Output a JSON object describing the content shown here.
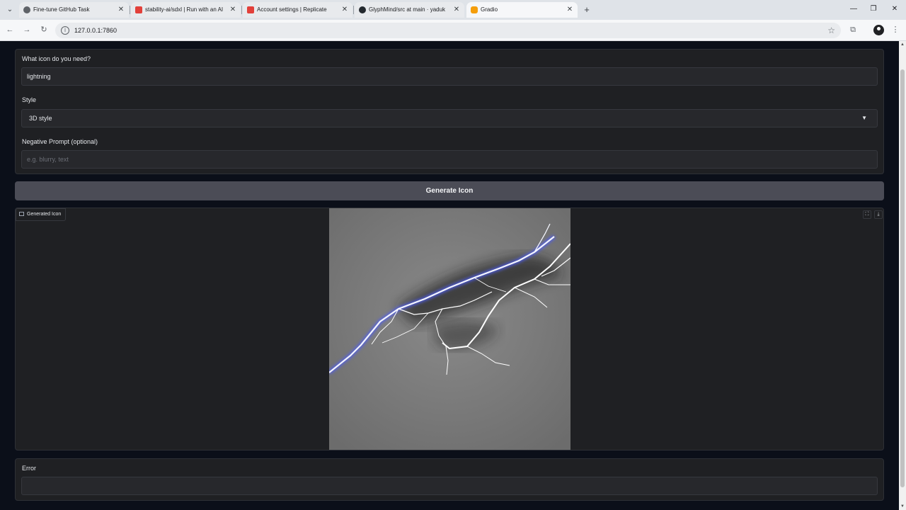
{
  "browser": {
    "tabs": [
      {
        "title": "Fine-tune GitHub Task",
        "active": false
      },
      {
        "title": "stability-ai/sdxl | Run with an AI",
        "active": false
      },
      {
        "title": "Account settings | Replicate",
        "active": false
      },
      {
        "title": "GlyphMind/src at main · yaduk",
        "active": false
      },
      {
        "title": "Gradio",
        "active": true
      }
    ],
    "close_glyph": "✕",
    "new_tab_glyph": "+",
    "url": "127.0.0.1:7860"
  },
  "form": {
    "icon_label": "What icon do you need?",
    "icon_value": "lightning",
    "style_label": "Style",
    "style_value": "3D style",
    "negative_label": "Negative Prompt (optional)",
    "negative_placeholder": "e.g. blurry, text"
  },
  "generate_button": "Generate Icon",
  "output": {
    "label": "Generated Icon",
    "image_description_icon": "lightning-image"
  },
  "error": {
    "label": "Error",
    "value": ""
  },
  "icons": {
    "tab_menu": "chevron-down-icon",
    "back": "back-arrow-icon",
    "forward": "forward-arrow-icon",
    "reload": "reload-icon",
    "fullscreen": "fullscreen-icon",
    "download": "download-icon"
  },
  "colors": {
    "page_bg": "#0b0f19",
    "panel_bg": "#1f2023",
    "button_bg": "#4b4c56"
  }
}
